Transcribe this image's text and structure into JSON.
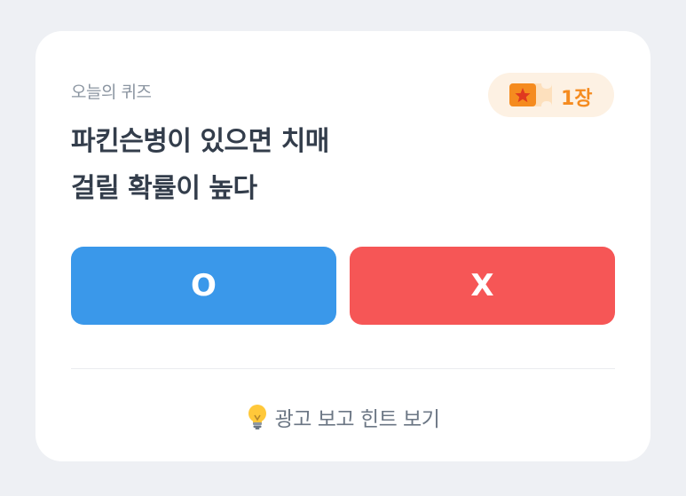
{
  "quiz": {
    "eyebrow": "오늘의 퀴즈",
    "question_lines": [
      "파킨슨병이 있으면 치매",
      "걸릴 확률이 높다"
    ],
    "ticket": {
      "icon": "ticket-star-icon",
      "count": "1장"
    },
    "answers": {
      "o_label": "O",
      "x_label": "X"
    },
    "hint": {
      "icon": "lightbulb-icon",
      "label": "광고 보고 힌트 보기"
    }
  },
  "colors": {
    "background": "#eef0f4",
    "card": "#ffffff",
    "o_button": "#3a98ea",
    "x_button": "#f65656",
    "ticket_bg": "#fdf1e3",
    "ticket_accent": "#f58b1f"
  }
}
